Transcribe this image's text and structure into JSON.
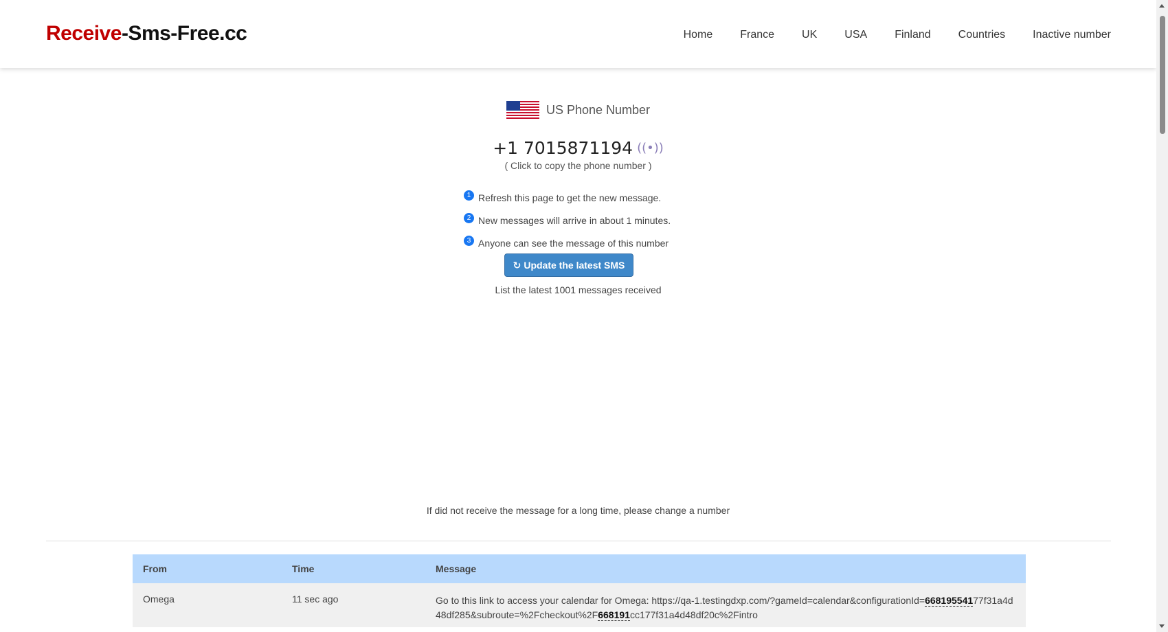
{
  "brand": {
    "part1": "Receive",
    "part2": "-Sms-Free.cc"
  },
  "nav": [
    "Home",
    "France",
    "UK",
    "USA",
    "Finland",
    "Countries",
    "Inactive number"
  ],
  "header": {
    "title": "US Phone Number",
    "flag": "us-flag-icon"
  },
  "phone": {
    "number": "+1 7015871194",
    "signal_icon": "((•))",
    "copy_hint": "( Click to copy the phone number )"
  },
  "steps": [
    {
      "num": "1",
      "text": "Refresh this page to get the new message."
    },
    {
      "num": "2",
      "text": "New messages will arrive in about 1 minutes."
    },
    {
      "num": "3",
      "text": "Anyone can see the message of this number"
    }
  ],
  "update_button": {
    "icon": "↻",
    "label": "Update the latest SMS"
  },
  "list_info": "List the latest 1001 messages received",
  "change_note": "If did not receive the message for a long time, please change a number",
  "table": {
    "headers": {
      "from": "From",
      "time": "Time",
      "message": "Message"
    },
    "rows": [
      {
        "from": "Omega",
        "time": "11 sec ago",
        "msg_part1": "Go to this link to access your calendar for Omega: https://qa-1.testingdxp.com/?gameId=calendar&configurationId=",
        "code1": "668195541",
        "msg_part2": "77f31a4d48df285&subroute=%2Fcheckout%2F",
        "code2": "668191",
        "msg_part3": "cc177f31a4d48df20c%2Fintro"
      }
    ]
  },
  "colors": {
    "brand_red": "#c00000",
    "button": "#3f88c9",
    "table_header": "#b8d9fd",
    "step_badge": "#1877f2"
  }
}
